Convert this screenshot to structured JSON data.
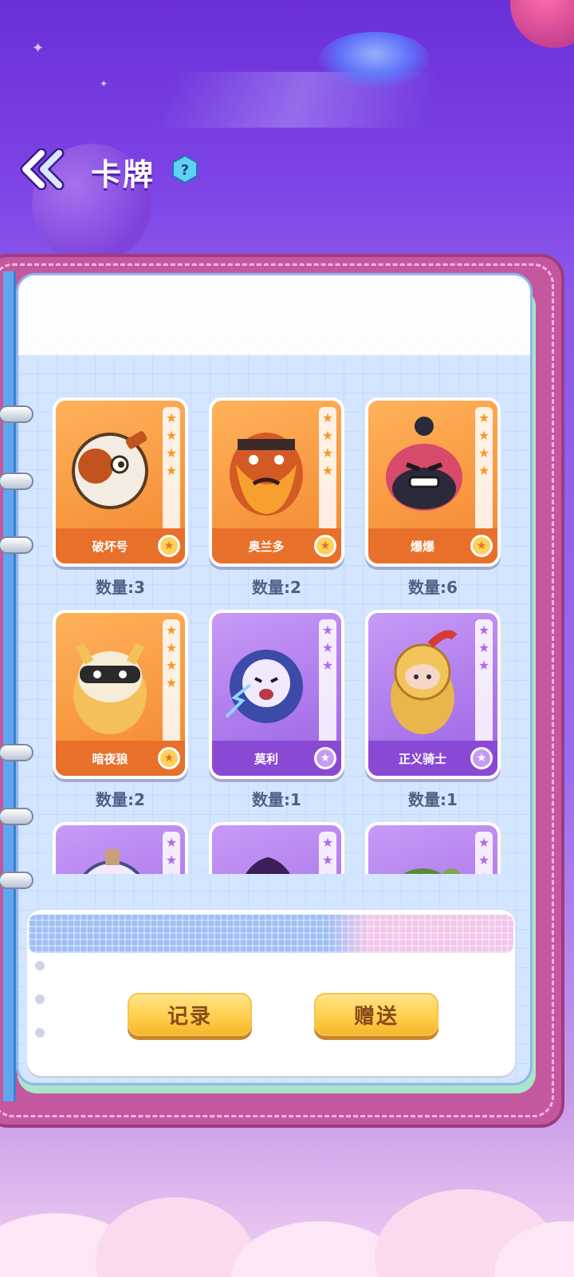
{
  "header": {
    "title": "卡牌",
    "help_label": "?"
  },
  "cards": [
    {
      "name": "破坏号",
      "count": "数量:3",
      "rarity": "orange",
      "stars": 4
    },
    {
      "name": "奥兰多",
      "count": "数量:2",
      "rarity": "orange",
      "stars": 4
    },
    {
      "name": "爆爆",
      "count": "数量:6",
      "rarity": "orange",
      "stars": 4
    },
    {
      "name": "暗夜狼",
      "count": "数量:2",
      "rarity": "orange",
      "stars": 4
    },
    {
      "name": "莫利",
      "count": "数量:1",
      "rarity": "purple",
      "stars": 3
    },
    {
      "name": "正义骑士",
      "count": "数量:1",
      "rarity": "purple",
      "stars": 3
    },
    {
      "name": "",
      "count": "",
      "rarity": "purple",
      "stars": 3
    },
    {
      "name": "",
      "count": "",
      "rarity": "purple",
      "stars": 3
    },
    {
      "name": "",
      "count": "",
      "rarity": "purple",
      "stars": 3
    }
  ],
  "buttons": {
    "record": "记录",
    "gift": "赠送"
  },
  "colors": {
    "background_top": "#6a2fd8",
    "card_orange": "#f3862f",
    "card_purple": "#9a62e3",
    "button_yellow": "#ffd04c",
    "count_text": "#4e5f87"
  }
}
